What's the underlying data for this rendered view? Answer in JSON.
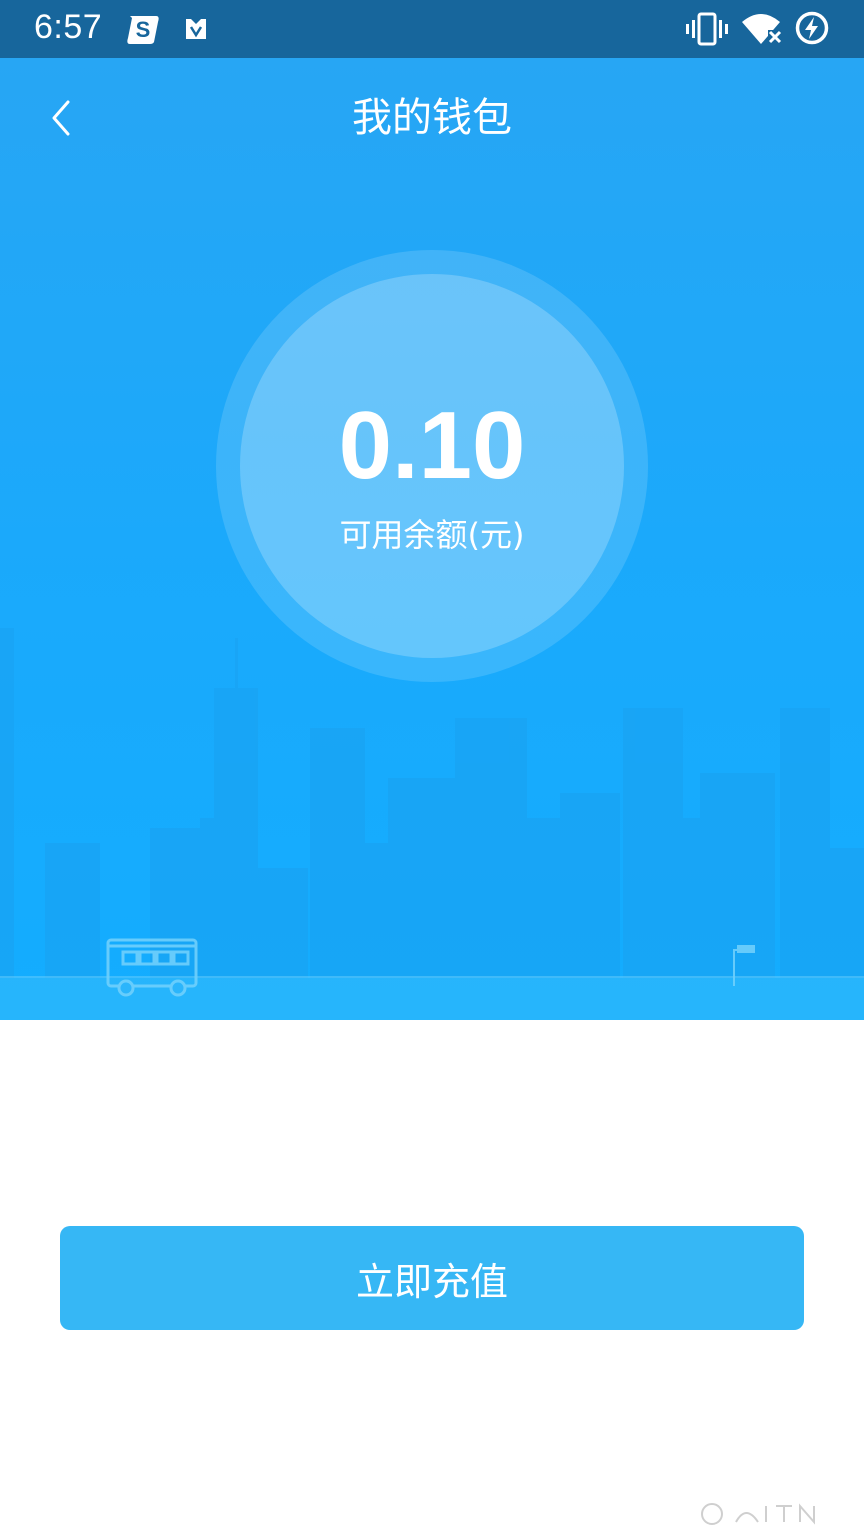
{
  "status_bar": {
    "time": "6:57",
    "icons": [
      "sogou-icon",
      "huawei-icon",
      "vibrate-icon",
      "wifi-off-icon",
      "battery-charging-icon"
    ]
  },
  "header": {
    "title": "我的钱包",
    "back_icon": "chevron-left-icon"
  },
  "wallet": {
    "balance": "0.10",
    "balance_label": "可用余额(元)"
  },
  "actions": {
    "recharge_label": "立即充值"
  },
  "colors": {
    "status_bar": "#17669c",
    "hero_top": "#27a6f4",
    "hero_bottom": "#13adff",
    "button": "#36b7f5"
  }
}
